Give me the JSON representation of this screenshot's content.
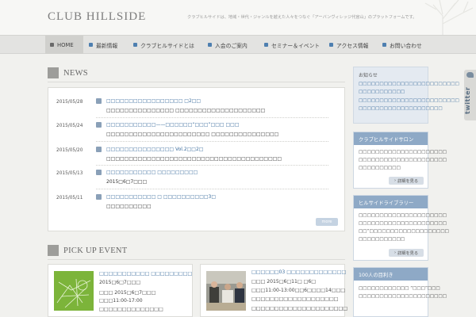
{
  "header": {
    "logo": "CLUB HILLSIDE",
    "tagline": "クラブヒルサイドは、地域・世代・ジャンルを越えた人々をつなぐ「アーバンヴィレッジ代官山」のプラットフォームです。"
  },
  "nav": {
    "items": [
      {
        "label": "HOME"
      },
      {
        "label": "最新情報"
      },
      {
        "label": "クラブヒルサイドとは"
      },
      {
        "label": "入会のご案内"
      },
      {
        "label": "セミナー＆イベント"
      },
      {
        "label": "アクセス情報"
      },
      {
        "label": "お問い合わせ"
      }
    ]
  },
  "news": {
    "title": "NEWS",
    "more_label": "more",
    "items": [
      {
        "date": "2015/05/28",
        "line1": "□□□□□□□□□□□□□□□□□ □2□□",
        "line2": "□□□□□□□□□□□□□□□ □□□□□□□□□□□□□□□□□□□□"
      },
      {
        "date": "2015/05/24",
        "line1": "□□□□□□□□□□□——□□□□□□“□□□”□□□ □□□",
        "line2": "□□□□□□□□□□□□□□□□□□□□□□□ □□□□□□□□□□□□□□□"
      },
      {
        "date": "2015/05/20",
        "line1": "□□□□□□□□□□□□□□□ Vol.2□□2□",
        "line2": "□□□□□□□□□□□□□□□□□□□□□□□□□□□□□□□□□□□□□□□"
      },
      {
        "date": "2015/05/13",
        "line1": "□□□□□□□□□□□ □□□□□□□□□",
        "line2": "2015□6□7□□□"
      },
      {
        "date": "2015/05/11",
        "line1": "□□□□□□□□□□□ □ □□□□□□□□□□3□",
        "line2": "□□□□□□□□□□"
      }
    ]
  },
  "pickup": {
    "title": "PICK UP EVENT",
    "cards": [
      {
        "l1": "□□□□□□□□□□□ □□□□□□□□□",
        "l2": "2015□6□7□□□",
        "l3": "□□□ 2015□6□7□□□",
        "l4": "□□□11:00-17:00",
        "l5": "□□□□□□□□□□□□□□"
      },
      {
        "l1": "□□□□□□03 □□□□□□□□□□□□□",
        "l2": "□□□ 2015□6□11□ □6□",
        "l3": "□□□11:00-13:00□□6□□□□14□□□",
        "l4": "□□□□□□□□□□□□□□□□□□□",
        "l5": "□□□□□□□□□□□□□□□□□□□□□"
      }
    ]
  },
  "sidebar": {
    "notice": {
      "heading": "お知らせ",
      "lines": [
        "□□□□□□□□□□□□□□□□□□□□□□□□",
        "□□□□□□□□□□□",
        "□□□□□□□□□□□□□□□□□□□□□□□□",
        "□□□□□□□□□□□□□□□□□□□□"
      ]
    },
    "boxes": [
      {
        "heading": "クラブヒルサイドサロン",
        "lines": [
          "□□□□□□□□□□□□□□□□□□□□□",
          "□□□□□□□□□□□□□□□□□□□□□",
          "□□□□□□□□□□"
        ],
        "button": "詳細を見る"
      },
      {
        "heading": "ヒルサイドライブラリー",
        "lines": [
          "□□□□□□□□□□□□□□□□□□□□□",
          "□□□□□□□□□□□□□□□□□□□□□",
          "□□“□□□□□□□□□□□□□□□□□□□",
          "□□□□□□□□□□□"
        ],
        "button": "詳細を見る"
      },
      {
        "heading": "100人の目利き",
        "lines": [
          "□□□□□□□□□□□□ “□□□”□□□",
          "□□□□□□□□□□□□□□□□□□□□□"
        ]
      }
    ],
    "twitter": "twitter"
  },
  "colors": {
    "accent": "#8ea9c6",
    "link": "#3d6e9e",
    "background": "#f1f1ee"
  }
}
